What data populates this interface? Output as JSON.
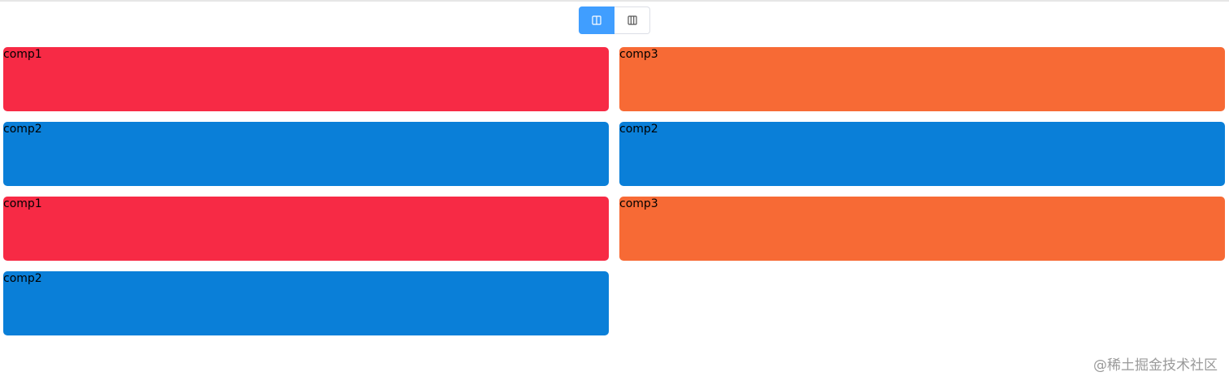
{
  "toolbar": {
    "buttons": [
      {
        "icon": "two-column-layout-icon",
        "active": true
      },
      {
        "icon": "three-column-layout-icon",
        "active": false
      }
    ]
  },
  "colors": {
    "comp1": "#f72a45",
    "comp2": "#0a7fd8",
    "comp3": "#f76a35",
    "accent": "#409eff"
  },
  "cards": [
    {
      "label": "comp1",
      "color": "#f72a45"
    },
    {
      "label": "comp3",
      "color": "#f76a35"
    },
    {
      "label": "comp2",
      "color": "#0a7fd8"
    },
    {
      "label": "comp2",
      "color": "#0a7fd8"
    },
    {
      "label": "comp1",
      "color": "#f72a45"
    },
    {
      "label": "comp3",
      "color": "#f76a35"
    },
    {
      "label": "comp2",
      "color": "#0a7fd8"
    }
  ],
  "watermark": "@稀土掘金技术社区"
}
